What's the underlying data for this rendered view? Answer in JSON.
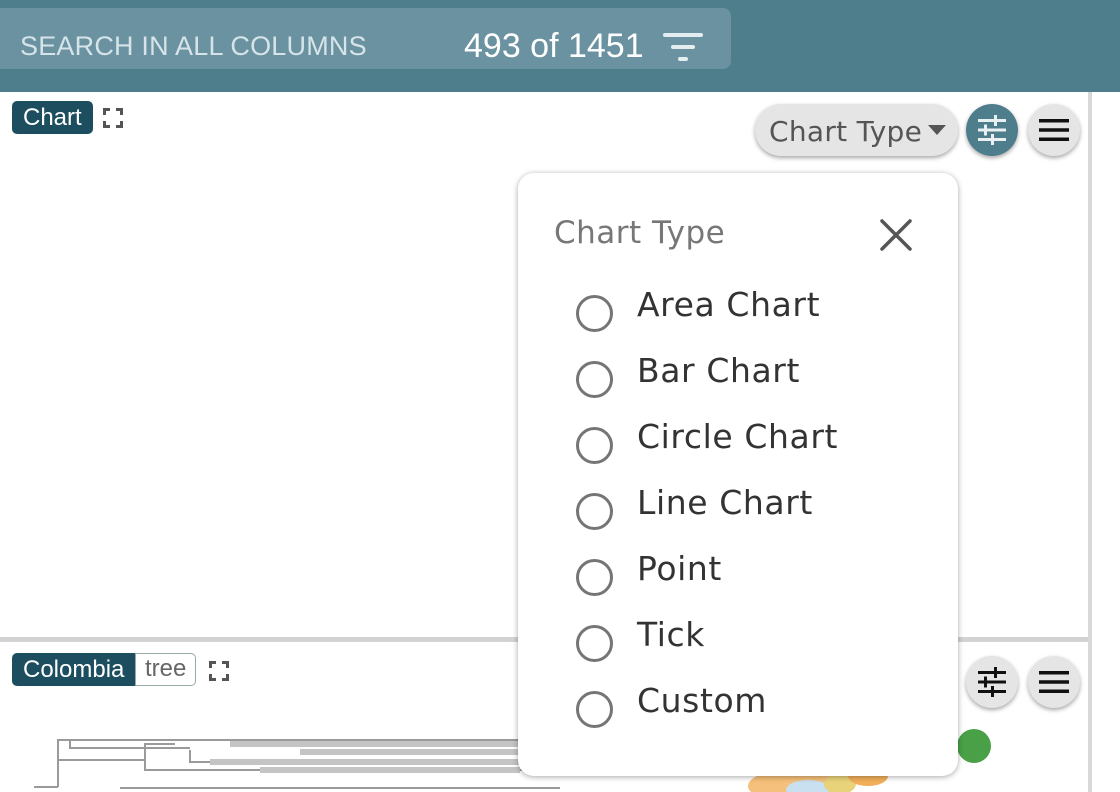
{
  "header": {
    "search_placeholder": "SEARCH IN ALL COLUMNS",
    "record_count": "493 of 1451",
    "filter_icon": "filter-icon"
  },
  "chart_panel": {
    "title_tag": "Chart",
    "expand_icon": "expand-icon",
    "chart_type_label": "Chart Type",
    "settings_icon": "sliders-icon",
    "menu_icon": "hamburger-menu-icon"
  },
  "chart_type_popup": {
    "title": "Chart Type",
    "close_icon": "close-icon",
    "options": [
      {
        "label": "Area Chart",
        "selected": false
      },
      {
        "label": "Bar Chart",
        "selected": false
      },
      {
        "label": "Circle Chart",
        "selected": false
      },
      {
        "label": "Line Chart",
        "selected": false
      },
      {
        "label": "Point",
        "selected": false
      },
      {
        "label": "Tick",
        "selected": false
      },
      {
        "label": "Custom",
        "selected": false
      }
    ]
  },
  "tree_panel": {
    "title_tag": "Colombia",
    "subtype_tag": "tree",
    "expand_icon": "expand-icon",
    "settings_icon": "sliders-icon",
    "menu_icon": "hamburger-menu-icon"
  },
  "colors": {
    "header_bg": "#4e7d8c",
    "search_bg": "#6a92a0",
    "tag_dark": "#1d4e5f",
    "accent_green": "#4aa047"
  }
}
